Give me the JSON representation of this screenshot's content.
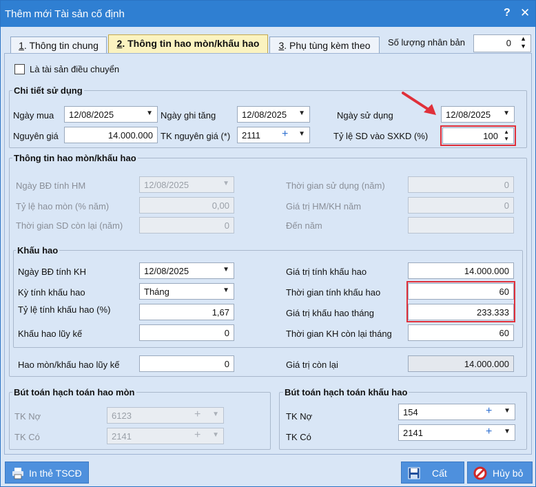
{
  "window": {
    "title": "Thêm mới Tài sản cố định",
    "help": "?",
    "close": "✕"
  },
  "tabs": [
    {
      "num": "1",
      "label": ". Thông tin chung"
    },
    {
      "num": "2",
      "label": ". Thông tin hao mòn/khấu hao"
    },
    {
      "num": "3",
      "label": ". Phụ tùng kèm theo"
    }
  ],
  "copy_count": {
    "label": "Số lượng nhân bản",
    "value": "0"
  },
  "transfer": {
    "label": "Là tài sản điều chuyển",
    "checked": false
  },
  "usage": {
    "title": "Chi tiết sử dụng",
    "purchase_date_label": "Ngày mua",
    "purchase_date": "12/08/2025",
    "increase_date_label": "Ngày ghi tăng",
    "increase_date": "12/08/2025",
    "use_date_label": "Ngày sử dụng",
    "use_date": "12/08/2025",
    "cost_label": "Nguyên giá",
    "cost": "14.000.000",
    "cost_account_label": "TK nguyên giá (*)",
    "cost_account": "2111",
    "business_ratio_label": "Tỷ lệ SD vào SXKD (%)",
    "business_ratio": "100"
  },
  "depreciation_info": {
    "title": "Thông tin hao mòn/khấu hao",
    "hm_start_label": "Ngày BĐ tính HM",
    "hm_start": "12/08/2025",
    "use_years_label": "Thời gian sử dụng (năm)",
    "use_years": "0",
    "hm_rate_label": "Tỷ lệ hao mòn (% năm)",
    "hm_rate": "0,00",
    "hm_value_label": "Giá trị HM/KH năm",
    "hm_value": "0",
    "remaining_years_label": "Thời gian SD còn lại (năm)",
    "remaining_years": "0",
    "to_year_label": "Đến năm",
    "to_year": ""
  },
  "amortization": {
    "title": "Khấu hao",
    "kh_start_label": "Ngày BĐ tính KH",
    "kh_start": "12/08/2025",
    "kh_value_label": "Giá trị tính khấu hao",
    "kh_value": "14.000.000",
    "period_label": "Kỳ tính khấu hao",
    "period": "Tháng",
    "months_label": "Thời gian tính khấu hao",
    "months": "60",
    "rate_label": "Tỷ lệ tính khấu hao (%)",
    "rate": "1,67",
    "monthly_label": "Giá trị khấu hao tháng",
    "monthly": "233.333",
    "accumulated_label": "Khấu hao lũy kế",
    "accumulated": "0",
    "remaining_months_label": "Thời gian KH còn lại tháng",
    "remaining_months": "60",
    "total_accumulated_label": "Hao mòn/khấu hao lũy kế",
    "total_accumulated": "0",
    "residual_label": "Giá trị còn lại",
    "residual": "14.000.000"
  },
  "wear_entries": {
    "title": "Bút toán hạch toán hao mòn",
    "debit_label": "TK Nợ",
    "debit": "6123",
    "credit_label": "TK Có",
    "credit": "2141"
  },
  "dep_entries": {
    "title": "Bút toán hạch toán khấu hao",
    "debit_label": "TK Nợ",
    "debit": "154",
    "credit_label": "TK Có",
    "credit": "2141"
  },
  "footer": {
    "print_label": "In thẻ TSCĐ",
    "save_label": "Cất",
    "cancel_label": "Hủy bỏ"
  },
  "colors": {
    "titlebar": "#2f7fd2",
    "panel": "#d9e6f6",
    "active_tab": "#fbf3c0",
    "highlight": "#e0303a",
    "button": "#4e90dd"
  }
}
